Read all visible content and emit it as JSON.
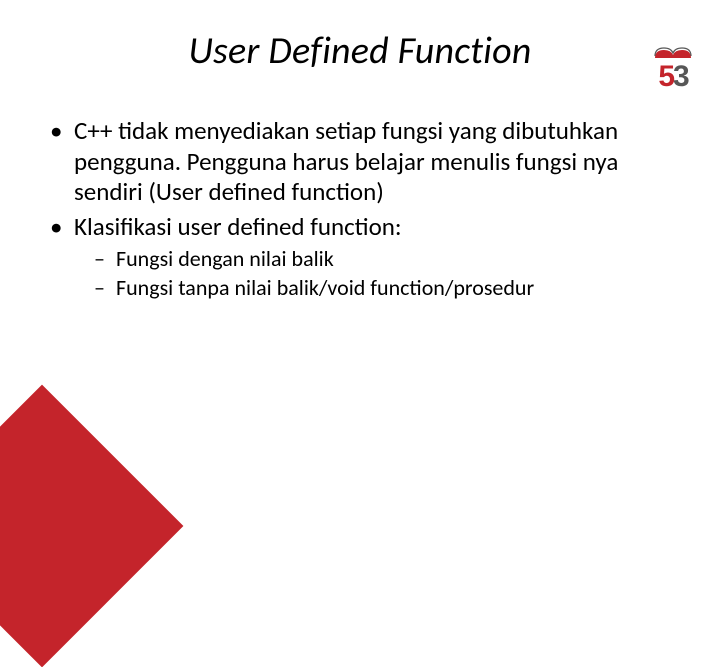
{
  "title": "User Defined Function",
  "bullets": {
    "b1": "C++ tidak menyediakan setiap fungsi yang dibutuhkan pengguna. Pengguna harus belajar menulis fungsi nya sendiri (User defined function)",
    "b2": "Klasifikasi user defined function:",
    "sub1": "Fungsi dengan nilai balik",
    "sub2": "Fungsi tanpa nilai balik/void function/prosedur"
  },
  "logo": {
    "glyph1": "5",
    "glyph2": "3"
  }
}
